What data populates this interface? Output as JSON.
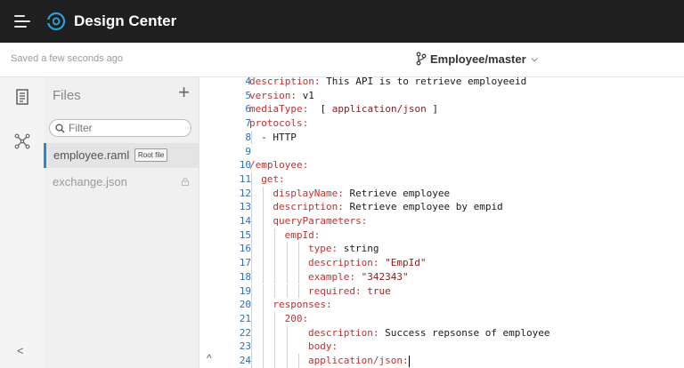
{
  "header": {
    "app_title": "Design Center",
    "logo_icon": "design-center-logo-icon",
    "menu_icon": "hamburger-icon"
  },
  "subheader": {
    "saved_text": "Saved a few seconds ago",
    "branch_label": "Employee/master"
  },
  "rail": {
    "items": [
      "document-icon",
      "graph-icon"
    ],
    "collapse_label": "<"
  },
  "files_panel": {
    "title": "Files",
    "add_label": "+",
    "filter_placeholder": "Filter",
    "files": [
      {
        "name": "employee.raml",
        "badge": "Root file",
        "active": true
      },
      {
        "name": "exchange.json",
        "locked": true
      }
    ]
  },
  "editor": {
    "fold_label": "^",
    "lines": [
      {
        "n": "4",
        "indent": 0,
        "key": "description:",
        "value": " This API is to retrieve employeeid"
      },
      {
        "n": "5",
        "indent": 0,
        "key": "version:",
        "value": " v1"
      },
      {
        "n": "6",
        "indent": 0,
        "key": "mediaType:",
        "value": "  [ ",
        "str": "application/json",
        "tail": " ]"
      },
      {
        "n": "7",
        "indent": 0,
        "key": "protocols:",
        "value": ""
      },
      {
        "n": "8",
        "indent": 1,
        "key": "",
        "value": "- HTTP"
      },
      {
        "n": "9",
        "indent": 0,
        "key": "",
        "value": ""
      },
      {
        "n": "10",
        "indent": 0,
        "key": "/employee:",
        "value": ""
      },
      {
        "n": "11",
        "indent": 1,
        "key": "get:",
        "value": ""
      },
      {
        "n": "12",
        "indent": 2,
        "key": "displayName:",
        "value": " Retrieve employee"
      },
      {
        "n": "13",
        "indent": 2,
        "key": "description:",
        "value": " Retrieve employee by empid"
      },
      {
        "n": "14",
        "indent": 2,
        "key": "queryParameters:",
        "value": ""
      },
      {
        "n": "15",
        "indent": 3,
        "key": "empId:",
        "value": ""
      },
      {
        "n": "16",
        "indent": 5,
        "key": "type:",
        "value": " string"
      },
      {
        "n": "17",
        "indent": 5,
        "key": "description:",
        "value": " ",
        "str": "\"EmpId\""
      },
      {
        "n": "18",
        "indent": 5,
        "key": "example:",
        "value": " ",
        "str": "\"342343\""
      },
      {
        "n": "19",
        "indent": 5,
        "key": "required:",
        "value": " ",
        "bool": "true"
      },
      {
        "n": "20",
        "indent": 2,
        "key": "responses:",
        "value": ""
      },
      {
        "n": "21",
        "indent": 3,
        "key": "200:",
        "value": ""
      },
      {
        "n": "22",
        "indent": 4,
        "key": "description:",
        "value": " Success repsonse of employee"
      },
      {
        "n": "23",
        "indent": 4,
        "key": "body:",
        "value": ""
      },
      {
        "n": "24",
        "indent": 5,
        "key": "application/json:",
        "value": "",
        "cursor": true
      }
    ]
  },
  "colors": {
    "topbar": "#1f1f1f",
    "key": "#c03030",
    "line_number": "#2a6db5",
    "active_file_border": "#2b88c8"
  }
}
